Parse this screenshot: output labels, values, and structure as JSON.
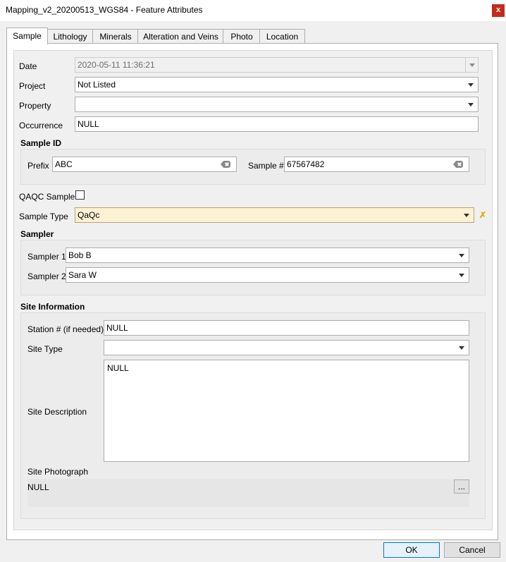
{
  "window": {
    "title": "Mapping_v2_20200513_WGS84 - Feature Attributes",
    "close_label": "x"
  },
  "tabs": [
    "Sample",
    "Lithology",
    "Minerals",
    "Alteration and Veins",
    "Photo",
    "Location"
  ],
  "form": {
    "date": {
      "label": "Date",
      "value": "2020-05-11 11:36:21"
    },
    "project": {
      "label": "Project",
      "value": "Not Listed"
    },
    "property": {
      "label": "Property",
      "value": ""
    },
    "occurrence": {
      "label": "Occurrence",
      "value": "NULL"
    },
    "sample_id": {
      "title": "Sample ID",
      "prefix_label": "Prefix",
      "prefix_value": "ABC",
      "number_label": "Sample #",
      "number_value": "67567482"
    },
    "qaqc": {
      "label": "QAQC Sample?",
      "checked": false
    },
    "sample_type": {
      "label": "Sample Type",
      "value": "QaQc",
      "reset_symbol": "✗"
    },
    "sampler": {
      "title": "Sampler",
      "sampler1_label": "Sampler 1",
      "sampler1_value": "Bob B",
      "sampler2_label": "Sampler 2",
      "sampler2_value": "Sara W"
    },
    "site": {
      "title": "Site Information",
      "station_label": "Station # (if needed)",
      "station_value": "NULL",
      "type_label": "Site Type",
      "type_value": "",
      "description_label": "Site Description",
      "description_value": "NULL",
      "photo_label": "Site Photograph",
      "photo_value": "NULL",
      "browse_label": "..."
    }
  },
  "footer": {
    "ok_label": "OK",
    "cancel_label": "Cancel"
  },
  "colors": {
    "highlight_field": "#fdf1d4",
    "reset_icon": "#e0a800",
    "default_button_border": "#0078d7"
  }
}
